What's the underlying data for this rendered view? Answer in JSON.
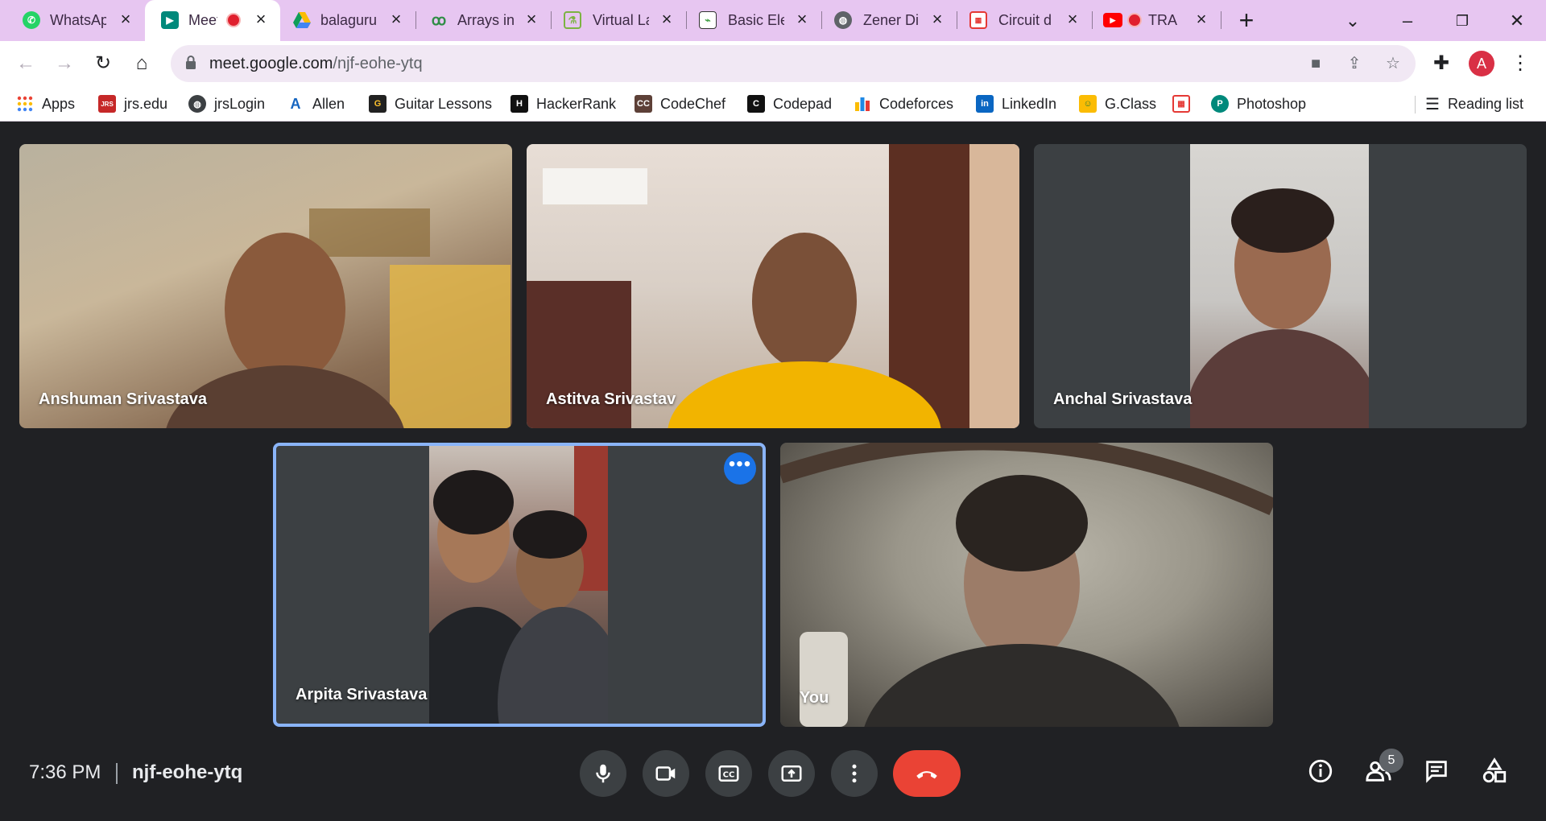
{
  "browser": {
    "tabs": [
      {
        "title": "WhatsApp",
        "favicon": "whatsapp-icon",
        "color": "#25d366",
        "active": false
      },
      {
        "title": "Meet",
        "favicon": "google-meet-icon",
        "color": "#00897b",
        "active": true,
        "recording": true
      },
      {
        "title": "balaguru",
        "favicon": "google-drive-icon",
        "color": "#fbbc04",
        "active": false
      },
      {
        "title": "Arrays in",
        "favicon": "geeksforgeeks-icon",
        "color": "#2f8d46",
        "active": false
      },
      {
        "title": "Virtual La",
        "favicon": "virtual-lab-icon",
        "color": "#7cb342",
        "active": false
      },
      {
        "title": "Basic Ele",
        "favicon": "electronics-icon",
        "color": "#43a047",
        "active": false
      },
      {
        "title": "Zener Di",
        "favicon": "globe-icon",
        "color": "#5f6368",
        "active": false
      },
      {
        "title": "Circuit d",
        "favicon": "circuit-icon",
        "color": "#e53935",
        "active": false
      },
      {
        "title": "TRAN",
        "favicon": "youtube-icon",
        "color": "#ff0000",
        "active": false,
        "recording": true
      }
    ],
    "url_host": "meet.google.com",
    "url_path": "/njf-eohe-ytq",
    "profile_initial": "A"
  },
  "bookmarks": [
    {
      "label": "Apps",
      "icon": "apps-grid-icon",
      "color": "#ea4335"
    },
    {
      "label": "jrs.edu",
      "icon": "jrs-icon",
      "color": "#c62828"
    },
    {
      "label": "jrsLogin",
      "icon": "globe-icon",
      "color": "#3c4043"
    },
    {
      "label": "Allen",
      "icon": "allen-icon",
      "color": "#1565c0"
    },
    {
      "label": "Guitar Lessons",
      "icon": "guitar-icon",
      "color": "#212121"
    },
    {
      "label": "HackerRank",
      "icon": "hackerrank-icon",
      "color": "#111111"
    },
    {
      "label": "CodeChef",
      "icon": "codechef-icon",
      "color": "#5d4037"
    },
    {
      "label": "Codepad",
      "icon": "codepad-icon",
      "color": "#111111"
    },
    {
      "label": "Codeforces",
      "icon": "codeforces-icon",
      "color": "#1e88e5"
    },
    {
      "label": "LinkedIn",
      "icon": "linkedin-icon",
      "color": "#0a66c2"
    },
    {
      "label": "G.Class",
      "icon": "google-classroom-icon",
      "color": "#fbbc04"
    },
    {
      "label": "",
      "icon": "circuit-icon",
      "color": "#e53935"
    },
    {
      "label": "Photoshop",
      "icon": "photoshop-icon",
      "color": "#00897b"
    }
  ],
  "reading_list": "Reading list",
  "participants": [
    {
      "name": "Anshuman Srivastava",
      "video": "camera-feed",
      "palette": [
        "#b9b19e",
        "#8a6e55"
      ]
    },
    {
      "name": "Astitva Srivastav",
      "video": "camera-feed",
      "palette": [
        "#d9cfc6",
        "#7a4a34"
      ]
    },
    {
      "name": "Anchal Srivastava",
      "video": "camera-feed",
      "palette": [
        "#c8c6c3",
        "#5b3d3a"
      ]
    },
    {
      "name": "Arpita Srivastava",
      "video": "camera-feed",
      "palette": [
        "#7a5a4e",
        "#2a2a2e"
      ],
      "speaking": true
    },
    {
      "name": "You",
      "video": "camera-feed",
      "palette": [
        "#9a968a",
        "#3c3a36"
      ]
    }
  ],
  "meeting": {
    "time": "7:36 PM",
    "code": "njf-eohe-ytq",
    "people_count": "5"
  },
  "colors": {
    "hangup": "#ea4335",
    "speaking_border": "#8ab4f8",
    "tab_strip": "#e7c6f1"
  }
}
